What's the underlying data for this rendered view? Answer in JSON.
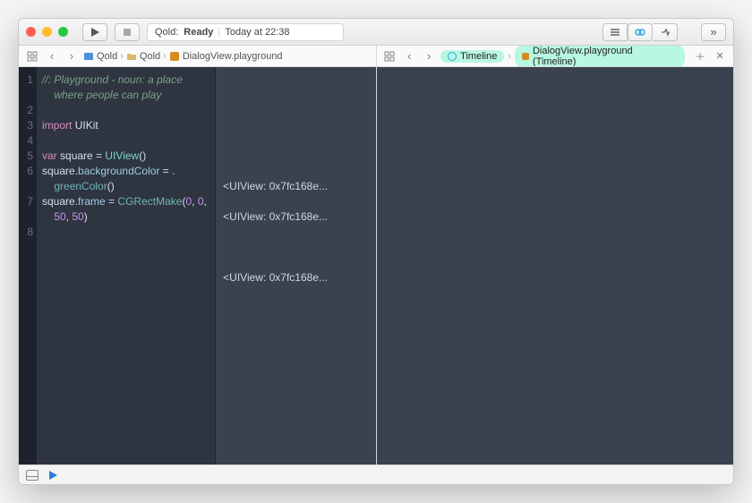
{
  "titlebar": {
    "status_project": "Qold:",
    "status_state": "Ready",
    "status_time": "Today at 22:38"
  },
  "jumpbar_left": {
    "crumb1": "Qold",
    "crumb2": "Qold",
    "crumb3": "DialogView.playground"
  },
  "jumpbar_right": {
    "pill1": "Timeline",
    "pill2": "DialogView.playground (Timeline)"
  },
  "gutter": [
    "1",
    "2",
    "3",
    "4",
    "5",
    "6",
    "7",
    "8"
  ],
  "code": {
    "l1a": "//: Playground - noun: a place",
    "l1b": "    where people can play",
    "l2": "",
    "l3_import": "import",
    "l3_mod": "UIKit",
    "l4": "",
    "l5_var": "var",
    "l5_name": "square",
    "l5_eq": " = ",
    "l5_type": "UIView",
    "l5_paren": "()",
    "l6_a": "square",
    "l6_dot1": ".",
    "l6_prop": "backgroundColor",
    "l6_eq": " = .",
    "l6b_indent": "    ",
    "l6b_func": "greenColor",
    "l6b_paren": "()",
    "l7_a": "square",
    "l7_dot": ".",
    "l7_frame": "frame",
    "l7_eq": " = ",
    "l7_func": "CGRectMake",
    "l7_op": "(",
    "l7_n0": "0",
    "l7_c1": ", ",
    "l7_n1": "0",
    "l7_c2": ",",
    "l7b_indent": "    ",
    "l7b_n2": "50",
    "l7b_c3": ", ",
    "l7b_n3": "50",
    "l7b_cp": ")",
    "l8": ""
  },
  "results": {
    "r5": "<UIView: 0x7fc168e...",
    "r6": "<UIView: 0x7fc168e...",
    "r7": "<UIView: 0x7fc168e..."
  }
}
